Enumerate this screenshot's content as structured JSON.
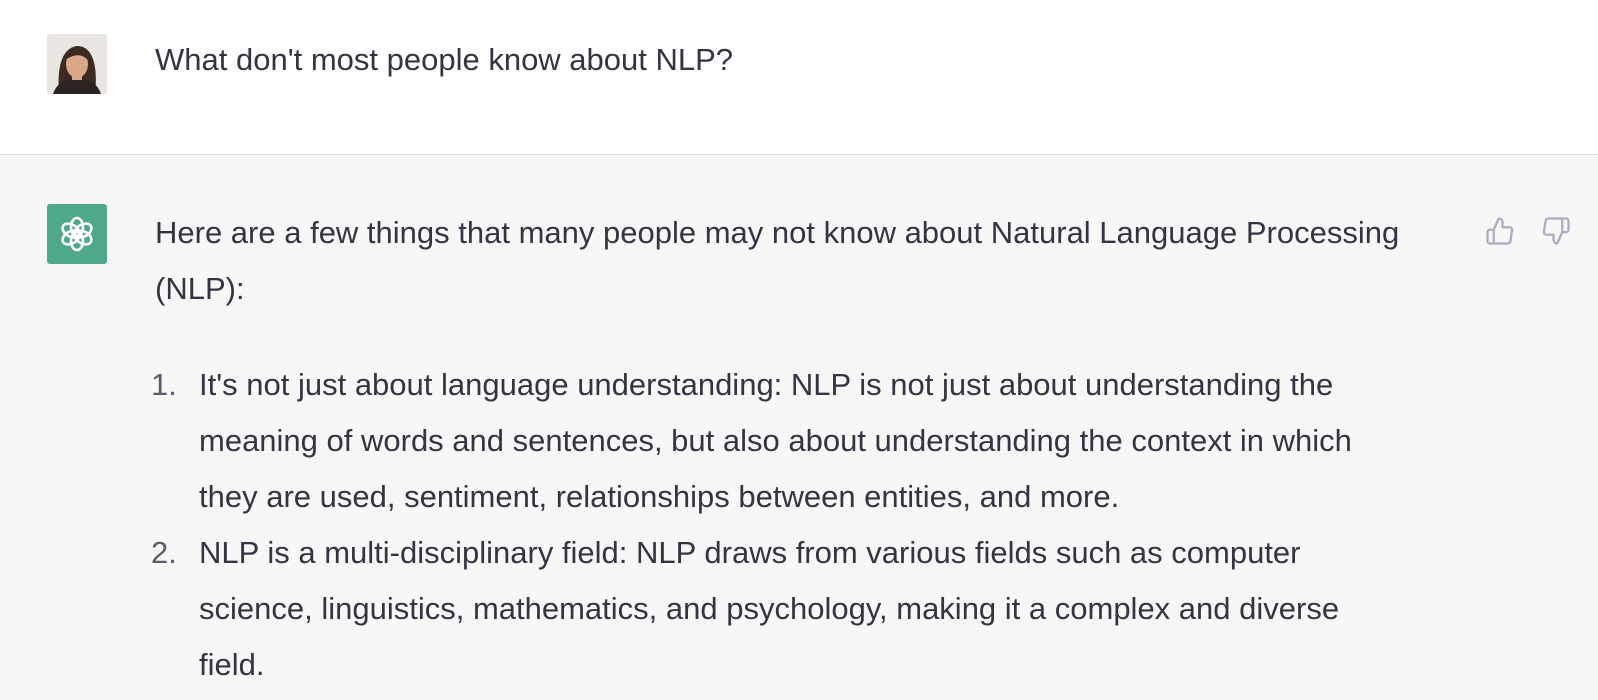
{
  "conversation": {
    "user_message": {
      "avatar": "user-photo-avatar",
      "text": "What don't most people know about NLP?"
    },
    "assistant_message": {
      "avatar": "openai-logo-icon",
      "accent_color": "#4fa888",
      "intro": "Here are a few things that many people may not know about Natural Language Processing (NLP):",
      "items": [
        {
          "number": "1.",
          "text": "It's not just about language understanding: NLP is not just about understanding the meaning of words and sentences, but also about understanding the context in which they are used, sentiment, relationships between entities, and more."
        },
        {
          "number": "2.",
          "text": "NLP is a multi-disciplinary field: NLP draws from various fields such as computer science, linguistics, mathematics, and psychology, making it a complex and diverse field."
        }
      ],
      "feedback": {
        "like_icon": "thumbs-up-icon",
        "dislike_icon": "thumbs-down-icon"
      }
    }
  }
}
